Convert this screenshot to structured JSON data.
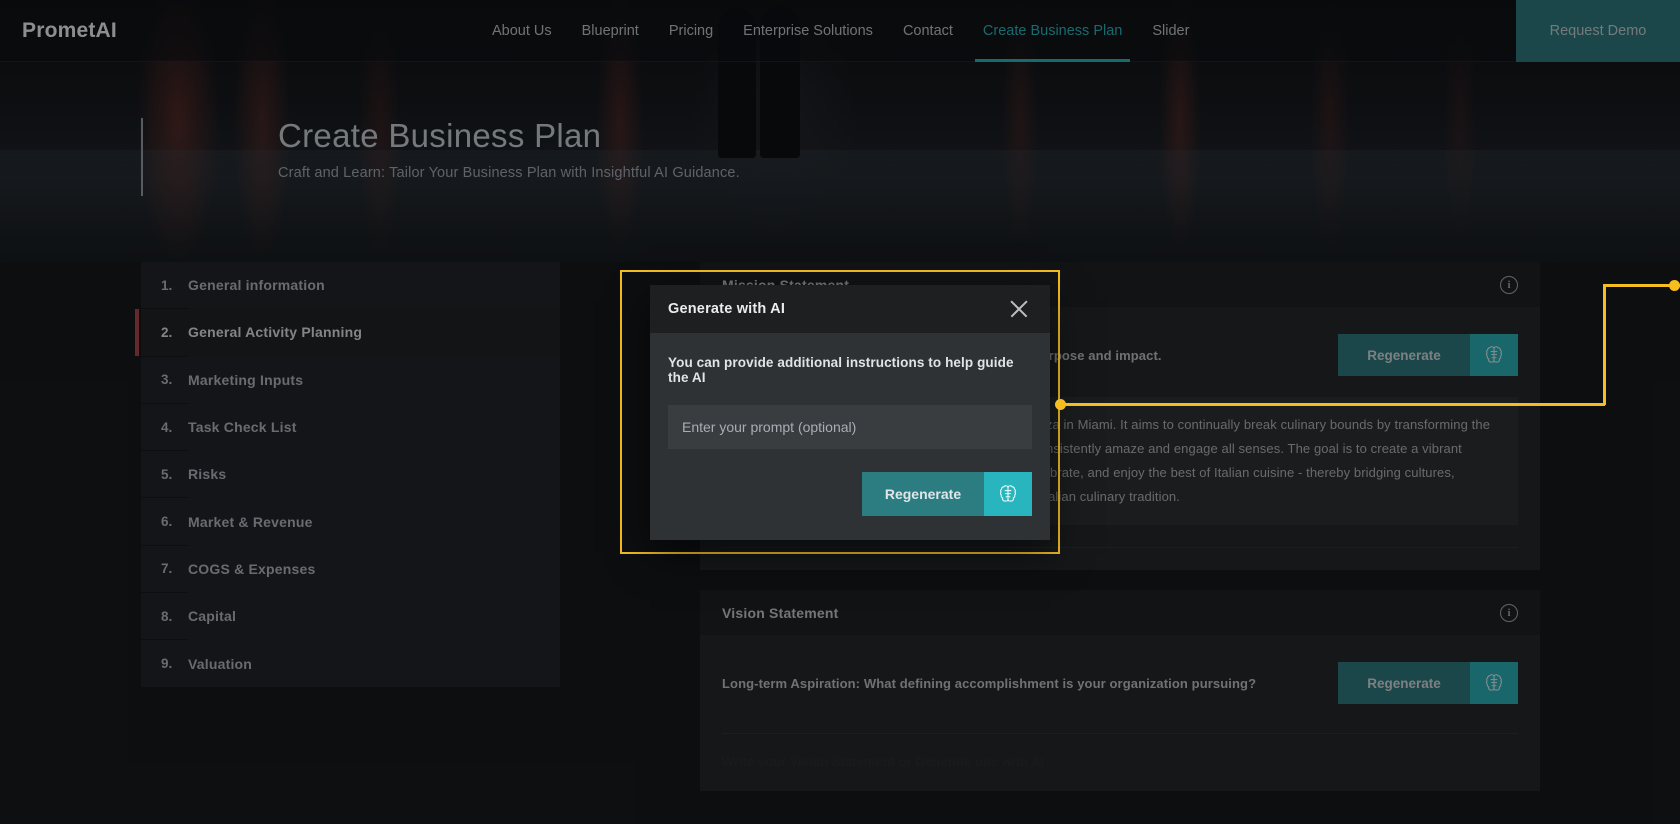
{
  "navbar": {
    "brand": "PrometAI",
    "links": [
      {
        "label": "About Us",
        "active": false
      },
      {
        "label": "Blueprint",
        "active": false
      },
      {
        "label": "Pricing",
        "active": false
      },
      {
        "label": "Enterprise Solutions",
        "active": false
      },
      {
        "label": "Contact",
        "active": false
      },
      {
        "label": "Create Business Plan",
        "active": true
      },
      {
        "label": "Slider",
        "active": false
      }
    ],
    "cta": "Request Demo",
    "accent_color": "#27bcc4",
    "cta_color": "#2b7d82"
  },
  "hero": {
    "title": "Create Business Plan",
    "subtitle": "Craft and Learn: Tailor Your Business Plan with Insightful AI Guidance."
  },
  "sidebar": {
    "items": [
      {
        "num": "1.",
        "label": "General information",
        "selected": false
      },
      {
        "num": "2.",
        "label": "General Activity Planning",
        "selected": true
      },
      {
        "num": "3.",
        "label": "Marketing Inputs",
        "selected": false
      },
      {
        "num": "4.",
        "label": "Task Check List",
        "selected": false
      },
      {
        "num": "5.",
        "label": "Risks",
        "selected": false
      },
      {
        "num": "6.",
        "label": "Market & Revenue",
        "selected": false
      },
      {
        "num": "7.",
        "label": "COGS & Expenses",
        "selected": false
      },
      {
        "num": "8.",
        "label": "Capital",
        "selected": false
      },
      {
        "num": "9.",
        "label": "Valuation",
        "selected": false
      }
    ],
    "selected_marker_color": "#b4444a"
  },
  "main": {
    "mission": {
      "title": "Mission Statement",
      "prompt": "Core Purpose: Describe your organization's core purpose and impact.",
      "regenerate_label": "Regenerate",
      "answer": "The mission is to deliver authentic Neapolitanian Pizza in Miami. It aims to continually break culinary bounds by transforming the finest ingredients into delicious masterpieces that consistently amaze and engage all senses. The goal is to create a vibrant environment where customers choose to gather, celebrate, and enjoy the best of Italian cuisine - thereby bridging cultures, bringing people closer, and spreading the charm of Italian culinary tradition."
    },
    "vision": {
      "title": "Vision Statement",
      "prompt": "Long-term Aspiration: What defining accomplishment is your organization pursuing?",
      "regenerate_label": "Regenerate",
      "footer_hint": "Write your Vision Statement or Generate one with AI"
    },
    "info_icon_glyph": "i"
  },
  "modal": {
    "title": "Generate with AI",
    "description": "You can provide additional instructions to help guide the AI",
    "input_placeholder": "Enter your prompt (optional)",
    "input_value": "",
    "regenerate_label": "Regenerate",
    "close_icon": "close-icon",
    "highlight_color": "#f5bd1f"
  }
}
